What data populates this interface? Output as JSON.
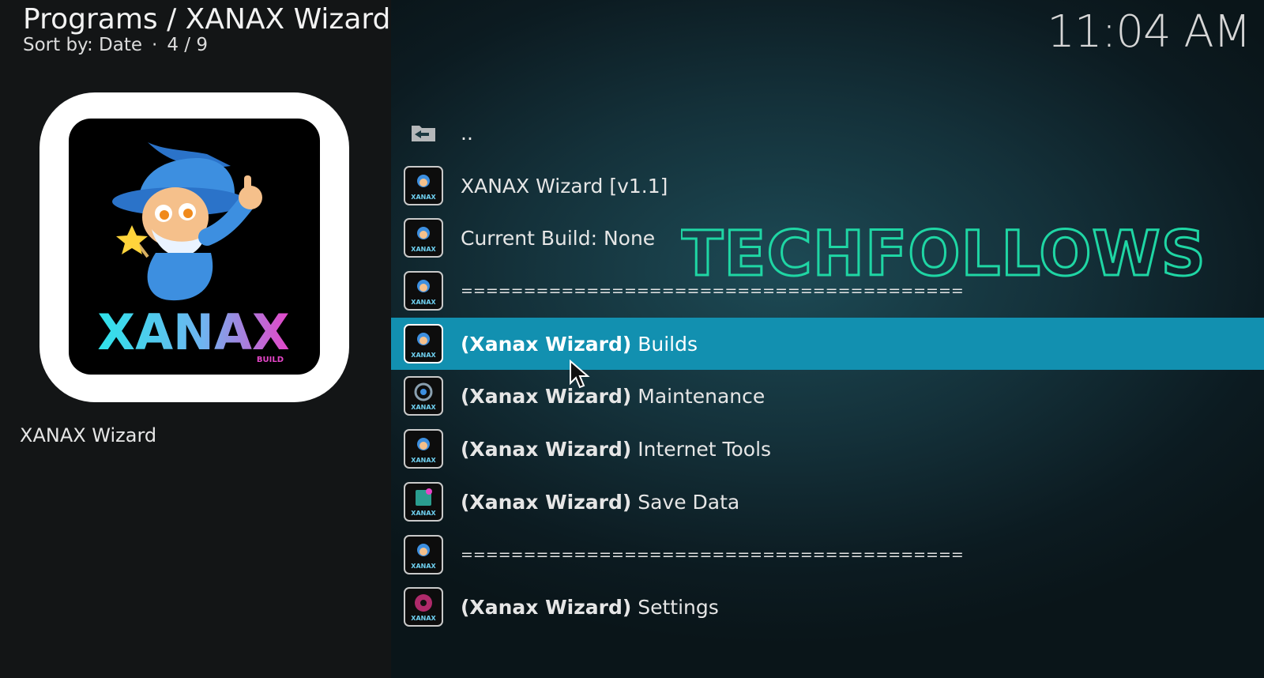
{
  "header": {
    "title": "Programs / XANAX Wizard",
    "sort_label": "Sort by: Date",
    "separator": "·",
    "position": "4 / 9"
  },
  "clock": "11:04 AM",
  "poster": {
    "logo_text": "XANAX",
    "logo_subtext": "BUILD",
    "label": "XANAX Wizard"
  },
  "watermark": "TECHFOLLOWS",
  "list": {
    "items": [
      {
        "icon": "back-folder-icon",
        "prefix": "",
        "label": ".."
      },
      {
        "icon": "xanax-wizard-icon",
        "prefix": "",
        "label": "XANAX Wizard [v1.1]"
      },
      {
        "icon": "xanax-wizard-icon",
        "prefix": "",
        "label": "Current Build: None"
      },
      {
        "icon": "xanax-wizard-icon",
        "prefix": "",
        "label": "========================================"
      },
      {
        "icon": "xanax-wizard-icon",
        "prefix": "(Xanax Wizard)",
        "label": " Builds",
        "selected": true
      },
      {
        "icon": "xanax-maintenance-icon",
        "prefix": "(Xanax Wizard)",
        "label": " Maintenance"
      },
      {
        "icon": "xanax-wizard-icon",
        "prefix": "(Xanax Wizard)",
        "label": " Internet Tools"
      },
      {
        "icon": "xanax-save-icon",
        "prefix": "(Xanax Wizard)",
        "label": " Save Data"
      },
      {
        "icon": "xanax-wizard-icon",
        "prefix": "",
        "label": "========================================"
      },
      {
        "icon": "xanax-settings-icon",
        "prefix": "(Xanax Wizard)",
        "label": " Settings"
      }
    ]
  },
  "colors": {
    "selected_row": "#1290b0",
    "watermark": "#1fd6a4",
    "logo_cyan": "#2fe3ea",
    "logo_pink": "#e546c8"
  }
}
